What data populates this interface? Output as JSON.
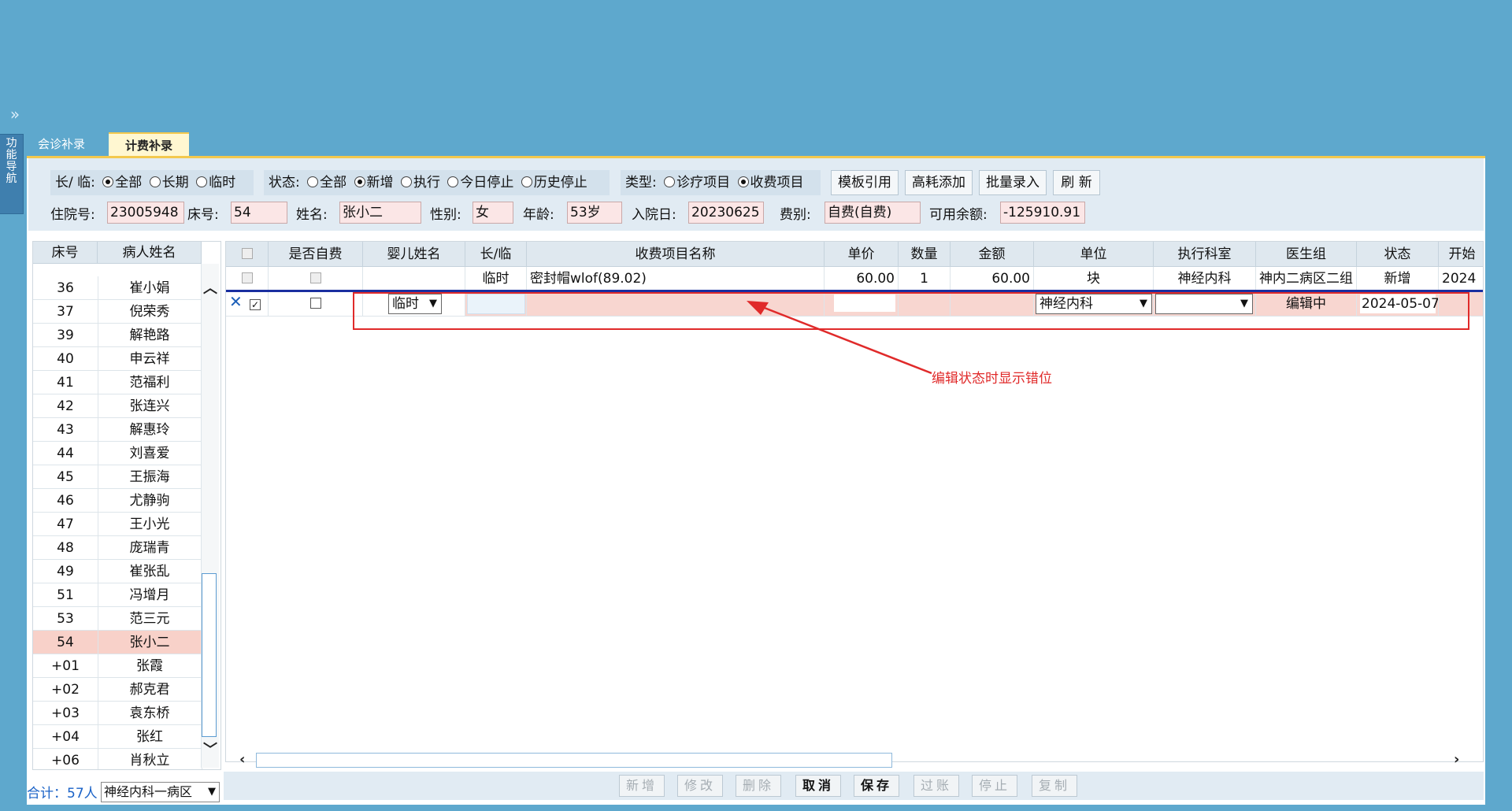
{
  "side_nav": {
    "expand_glyph": "»",
    "tab_chars": [
      "功",
      "能",
      "导",
      "航"
    ]
  },
  "tabs": [
    {
      "label": "会诊补录"
    },
    {
      "label": "计费补录"
    }
  ],
  "filters": {
    "type_label": "长/ 临:",
    "type_options": [
      "全部",
      "长期",
      "临时"
    ],
    "type_selected": "全部",
    "status_label": "状态:",
    "status_options": [
      "全部",
      "新增",
      "执行",
      "今日停止",
      "历史停止"
    ],
    "status_selected": "新增",
    "category_label": "类型:",
    "category_options": [
      "诊疗项目",
      "收费项目"
    ],
    "category_selected": "收费项目"
  },
  "toolbar": {
    "template": "模板引用",
    "high_cost": "高耗添加",
    "batch": "批量录入",
    "refresh": "刷 新"
  },
  "patient": {
    "admission_no_label": "住院号:",
    "admission_no": "23005948",
    "bed_label": "床号:",
    "bed": "54",
    "name_label": "姓名:",
    "name": "张小二",
    "gender_label": "性别:",
    "gender": "女",
    "age_label": "年龄:",
    "age": "53岁",
    "admit_date_label": "入院日:",
    "admit_date": "20230625",
    "fee_type_label": "费别:",
    "fee_type": "自费(自费)",
    "balance_label": "可用余额:",
    "balance": "-125910.91"
  },
  "bed_list": {
    "headers": [
      "床号",
      "病人姓名"
    ],
    "rows": [
      {
        "bed": "36",
        "name": "崔小娟"
      },
      {
        "bed": "37",
        "name": "倪荣秀"
      },
      {
        "bed": "39",
        "name": "解艳路"
      },
      {
        "bed": "40",
        "name": "申云祥"
      },
      {
        "bed": "41",
        "name": "范福利"
      },
      {
        "bed": "42",
        "name": "张连兴"
      },
      {
        "bed": "43",
        "name": "解惠玲"
      },
      {
        "bed": "44",
        "name": "刘喜爱"
      },
      {
        "bed": "45",
        "name": "王振海"
      },
      {
        "bed": "46",
        "name": "尤静驹"
      },
      {
        "bed": "47",
        "name": "王小光"
      },
      {
        "bed": "48",
        "name": "庞瑞青"
      },
      {
        "bed": "49",
        "name": "崔张乱"
      },
      {
        "bed": "51",
        "name": "冯增月"
      },
      {
        "bed": "53",
        "name": "范三元"
      },
      {
        "bed": "54",
        "name": "张小二"
      },
      {
        "bed": "+01",
        "name": "张霞"
      },
      {
        "bed": "+02",
        "name": "郝克君"
      },
      {
        "bed": "+03",
        "name": "袁东桥"
      },
      {
        "bed": "+04",
        "name": "张红"
      },
      {
        "bed": "+06",
        "name": "肖秋立"
      }
    ],
    "selected_bed": "54",
    "summary": "合计：57人",
    "dept": "神经内科一病区"
  },
  "grid": {
    "headers": [
      "是否自费",
      "婴儿姓名",
      "长/临",
      "收费项目名称",
      "单价",
      "数量",
      "金额",
      "单位",
      "执行科室",
      "医生组",
      "状态",
      "开始"
    ],
    "row1": {
      "type": "临时",
      "item": "密封帽wlof(89.02)",
      "price": "60.00",
      "qty": "1",
      "amount": "60.00",
      "unit": "块",
      "dept": "神经内科",
      "group": "神内二病区二组",
      "status": "新增",
      "start": "2024"
    },
    "edit_row": {
      "type": "临时",
      "unit": "神经内科",
      "status": "编辑中",
      "start": "2024-05-07"
    }
  },
  "actions": {
    "new": "新增",
    "modify": "修改",
    "delete": "删除",
    "cancel": "取消",
    "save": "保存",
    "post": "过账",
    "stop": "停止",
    "copy": "复制"
  },
  "annotation": {
    "text": "编辑状态时显示错位",
    "color": "#e02a2a"
  },
  "colors": {
    "background": "#5ea8cd",
    "tab_active": "#fff7d1",
    "accent_bar": "#f3c94e",
    "selected_row": "#f8d1c9",
    "edit_row": "#f8d6d0",
    "field_bg": "#fbe6e6"
  }
}
